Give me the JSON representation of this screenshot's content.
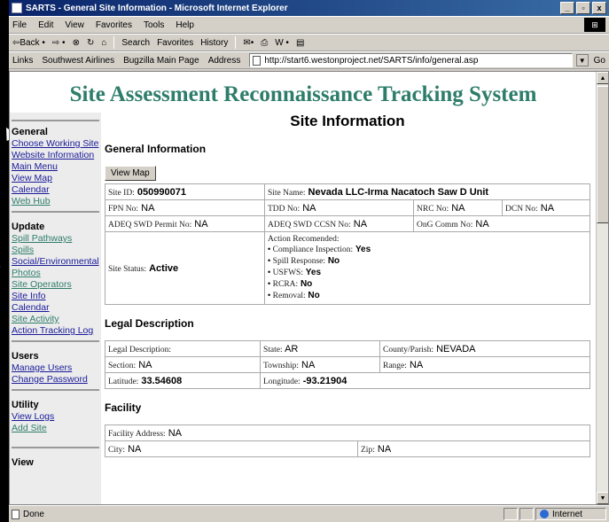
{
  "window": {
    "title": "SARTS - General Site Information - Microsoft Internet Explorer",
    "min": "_",
    "max": "▫",
    "close": "x"
  },
  "menu": [
    "File",
    "Edit",
    "View",
    "Favorites",
    "Tools",
    "Help"
  ],
  "toolbar": {
    "back": "⇦Back •",
    "forward": "⇨ •",
    "stop": "⊗",
    "refresh": "↻",
    "home": "⌂",
    "search": "Search",
    "favorites": "Favorites",
    "history": "History",
    "mail": "✉•",
    "print": "⎙",
    "edit": "W •",
    "discuss": "▤"
  },
  "linksbar": {
    "label": "Links",
    "links": [
      "Southwest Airlines",
      "Bugzilla Main Page"
    ],
    "address_label": "Address",
    "url": "http://start6.westonproject.net/SARTS/info/general.asp",
    "go": "Go"
  },
  "banner": "Site Assessment Reconnaissance Tracking System",
  "nav": {
    "general": {
      "header": "General",
      "items": [
        "Choose Working Site",
        "Website Information",
        "Main Menu",
        "View Map",
        "Calendar",
        "Web Hub"
      ]
    },
    "update": {
      "header": "Update",
      "items": [
        "Spill Pathways",
        "Spills",
        "Social/Environmental",
        "Photos",
        "Site Operators",
        "Site Info",
        "Calendar",
        "Site Activity",
        "Action Tracking Log"
      ]
    },
    "users": {
      "header": "Users",
      "items": [
        "Manage Users",
        "Change Password"
      ]
    },
    "utility": {
      "header": "Utility",
      "items": [
        "View Logs",
        "Add Site"
      ]
    },
    "view": {
      "header": "View"
    }
  },
  "page": {
    "title": "Site Information"
  },
  "general": {
    "heading": "General Information",
    "view_map": "View Map",
    "site_id_label": "Site ID:",
    "site_id": "050990071",
    "site_name_label": "Site Name:",
    "site_name": "Nevada LLC-Irma Nacatoch Saw D Unit",
    "fpn_label": "FPN No:",
    "fpn": "NA",
    "tdd_label": "TDD No:",
    "tdd": "NA",
    "nrc_label": "NRC No:",
    "nrc": "NA",
    "dcn_label": "DCN No:",
    "dcn": "NA",
    "adeq_permit_label": "ADEQ SWD Permit No:",
    "adeq_permit": "NA",
    "adeq_ccsn_label": "ADEQ SWD CCSN No:",
    "adeq_ccsn": "NA",
    "ong_label": "OnG Comm No:",
    "ong": "NA",
    "status_label": "Site Status:",
    "status": "Active",
    "action_label": "Action Recomended:",
    "actions": [
      {
        "label": "Compliance Inspection:",
        "value": "Yes"
      },
      {
        "label": "Spill Response:",
        "value": "No"
      },
      {
        "label": "USFWS:",
        "value": "Yes"
      },
      {
        "label": "RCRA:",
        "value": "No"
      },
      {
        "label": "Removal:",
        "value": "No"
      }
    ]
  },
  "legal": {
    "heading": "Legal Description",
    "desc_label": "Legal Description:",
    "desc": "",
    "state_label": "State:",
    "state": "AR",
    "county_label": "County/Parish:",
    "county": "NEVADA",
    "section_label": "Section:",
    "section": "NA",
    "township_label": "Township:",
    "township": "NA",
    "range_label": "Range:",
    "range": "NA",
    "lat_label": "Latitude:",
    "lat": "33.54608",
    "lon_label": "Longitude:",
    "lon": "-93.21904"
  },
  "facility": {
    "heading": "Facility",
    "addr_label": "Facility Address:",
    "addr": "NA",
    "city_label": "City:",
    "city": "NA",
    "zip_label": "Zip:",
    "zip": "NA"
  },
  "status": {
    "text": "Done",
    "zone": "Internet"
  }
}
